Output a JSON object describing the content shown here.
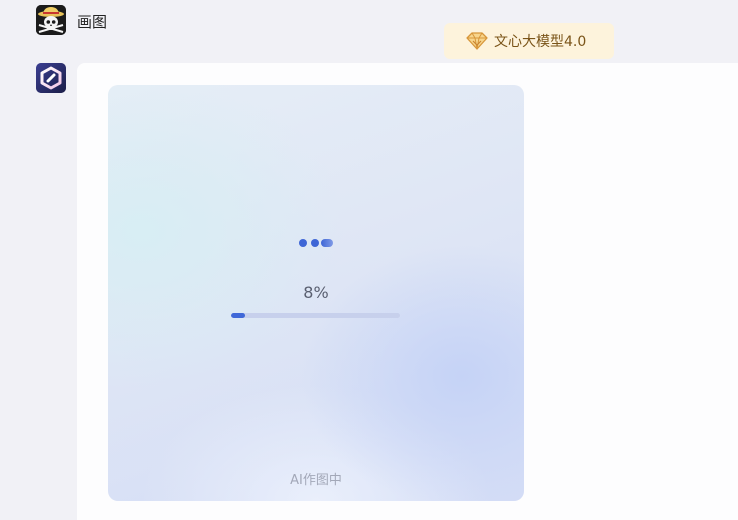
{
  "user_message": {
    "text": "画图",
    "avatar_icon": "skull-straw-hat-avatar-icon"
  },
  "model_badge": {
    "icon": "diamond-gem-icon",
    "label": "文心大模型4.0",
    "background_color": "#fdf3dc",
    "text_color": "#7a5418"
  },
  "bot_response": {
    "avatar_icon": "ernie-bot-logo-icon",
    "image_generation": {
      "loading_indicator": "loading-dots-icon",
      "progress_text": "8%",
      "progress_value": 0.08,
      "status_caption": "AI作图中",
      "accent_color": "#4068d8"
    }
  }
}
